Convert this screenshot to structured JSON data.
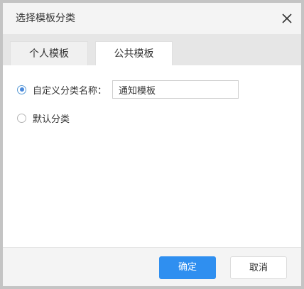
{
  "dialog": {
    "title": "选择模板分类",
    "close_icon": "close-icon"
  },
  "tabs": [
    {
      "label": "个人模板",
      "active": false
    },
    {
      "label": "公共模板",
      "active": true
    }
  ],
  "options": {
    "custom": {
      "label": "自定义分类名称：",
      "checked": true,
      "input_value": "通知模板"
    },
    "default": {
      "label": "默认分类",
      "checked": false
    }
  },
  "footer": {
    "ok_label": "确定",
    "cancel_label": "取消"
  },
  "colors": {
    "accent": "#2f8ff0",
    "radio_checked": "#4a89dc",
    "header_bg": "#f4f4f4",
    "tabbar_bg": "#e6e6e6"
  }
}
